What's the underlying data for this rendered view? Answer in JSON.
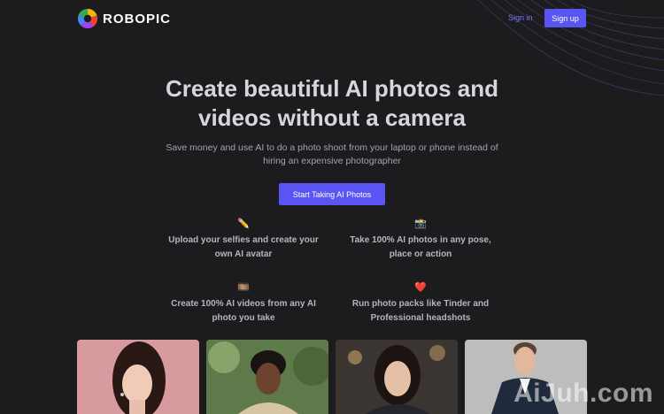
{
  "nav": {
    "brand": "ROBOPIC",
    "signin_label": "Sign in",
    "signup_label": "Sign up"
  },
  "hero": {
    "title_line1": "Create beautiful AI photos and",
    "title_line2": "videos without a camera",
    "subtitle_line1": "Save money and use AI to do a photo shoot from your laptop or phone instead of",
    "subtitle_line2": "hiring an expensive photographer",
    "cta_label": "Start Taking AI Photos"
  },
  "features": [
    {
      "icon": "pencil-icon",
      "glyph": "✏️",
      "line1": "Upload your selfies and create your",
      "line2": "own AI avatar"
    },
    {
      "icon": "camera-icon",
      "glyph": "📸",
      "line1": "Take 100% AI photos in any pose,",
      "line2": "place or action"
    },
    {
      "icon": "film-icon",
      "glyph": "🎞️",
      "line1": "Create 100% AI videos from any AI",
      "line2": "photo you take"
    },
    {
      "icon": "heart-icon",
      "glyph": "❤️",
      "line1": "Run photo packs like Tinder and",
      "line2": "Professional headshots"
    }
  ],
  "watermark": "AiJuh.com",
  "colors": {
    "background": "#1c1c1f",
    "accent": "#5a55f2",
    "link": "#7b79ff"
  }
}
